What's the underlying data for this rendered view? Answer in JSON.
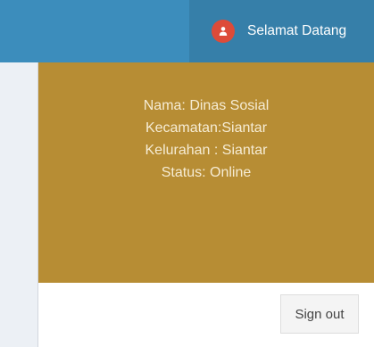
{
  "header": {
    "greeting": "Selamat Datang"
  },
  "user_panel": {
    "nama": "Nama: Dinas Sosial",
    "kecamatan": "Kecamatan:Siantar",
    "kelurahan": "Kelurahan : Siantar",
    "status": "Status: Online"
  },
  "footer": {
    "signout_label": "Sign out"
  },
  "colors": {
    "topbar": "#3c8dbc",
    "topbar_active": "#367fa9",
    "avatar": "#dd4b39",
    "user_header": "#b78d34"
  },
  "icons": {
    "avatar": "user-icon"
  }
}
